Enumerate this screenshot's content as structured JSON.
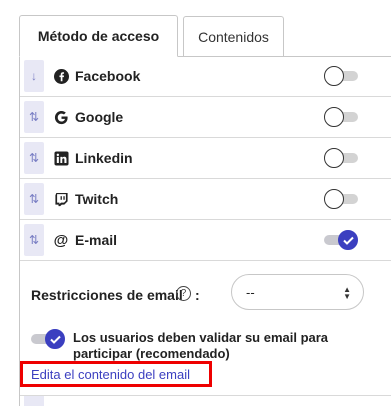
{
  "tabs": [
    {
      "label": "Método de acceso",
      "active": true
    },
    {
      "label": "Contenidos",
      "active": false
    }
  ],
  "providers": [
    {
      "name": "Facebook",
      "icon": "facebook-icon",
      "enabled": false
    },
    {
      "name": "Google",
      "icon": "google-icon",
      "enabled": false
    },
    {
      "name": "Linkedin",
      "icon": "linkedin-icon",
      "enabled": false
    },
    {
      "name": "Twitch",
      "icon": "twitch-icon",
      "enabled": false
    },
    {
      "name": "E-mail",
      "icon": "at-icon",
      "enabled": true
    }
  ],
  "restrictions": {
    "label": "Restricciones de email",
    "help": "?",
    "colon": ":",
    "selected": "--"
  },
  "validate": {
    "enabled": true,
    "text": "Los usuarios deben validar su email para participar (recomendado)"
  },
  "edit_link": "Edita el contenido del email",
  "colors": {
    "accent": "#3b3fc0",
    "highlight_border": "#ee0000",
    "handle_bg": "#e8e8f5"
  }
}
